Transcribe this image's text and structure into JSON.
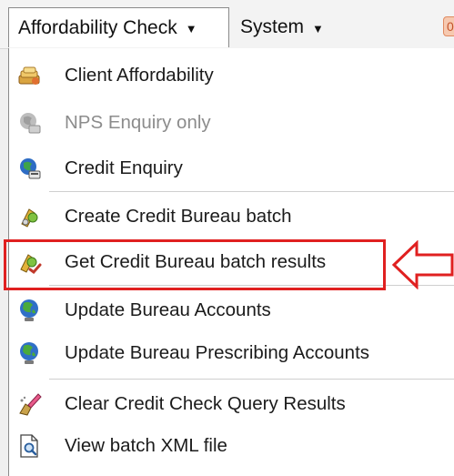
{
  "menubar": {
    "affordability_label": "Affordability Check",
    "affordability_caret": "▼",
    "system_label": "System",
    "system_caret": "▼",
    "extra_glyph": "0"
  },
  "menu": {
    "items": [
      {
        "label": "Client Affordability",
        "icon": "client-affordability-icon",
        "enabled": true
      },
      {
        "label": "NPS Enquiry only",
        "icon": "nps-enquiry-icon",
        "enabled": false
      },
      {
        "label": "Credit Enquiry",
        "icon": "credit-enquiry-icon",
        "enabled": true
      },
      {
        "label": "Create Credit Bureau batch",
        "icon": "create-batch-icon",
        "enabled": true
      },
      {
        "label": "Get Credit Bureau batch results",
        "icon": "batch-results-icon",
        "enabled": true
      },
      {
        "label": "Update Bureau Accounts",
        "icon": "globe-icon",
        "enabled": true,
        "annotated": true
      },
      {
        "label": "Update Bureau Prescribing Accounts",
        "icon": "globe-icon",
        "enabled": true
      },
      {
        "label": "Clear Credit Check Query Results",
        "icon": "clear-results-icon",
        "enabled": true
      },
      {
        "label": "View batch XML file",
        "icon": "view-xml-icon",
        "enabled": true
      }
    ]
  },
  "colors": {
    "annotation_red": "#e02020",
    "disabled_text": "#8c8c8c"
  }
}
